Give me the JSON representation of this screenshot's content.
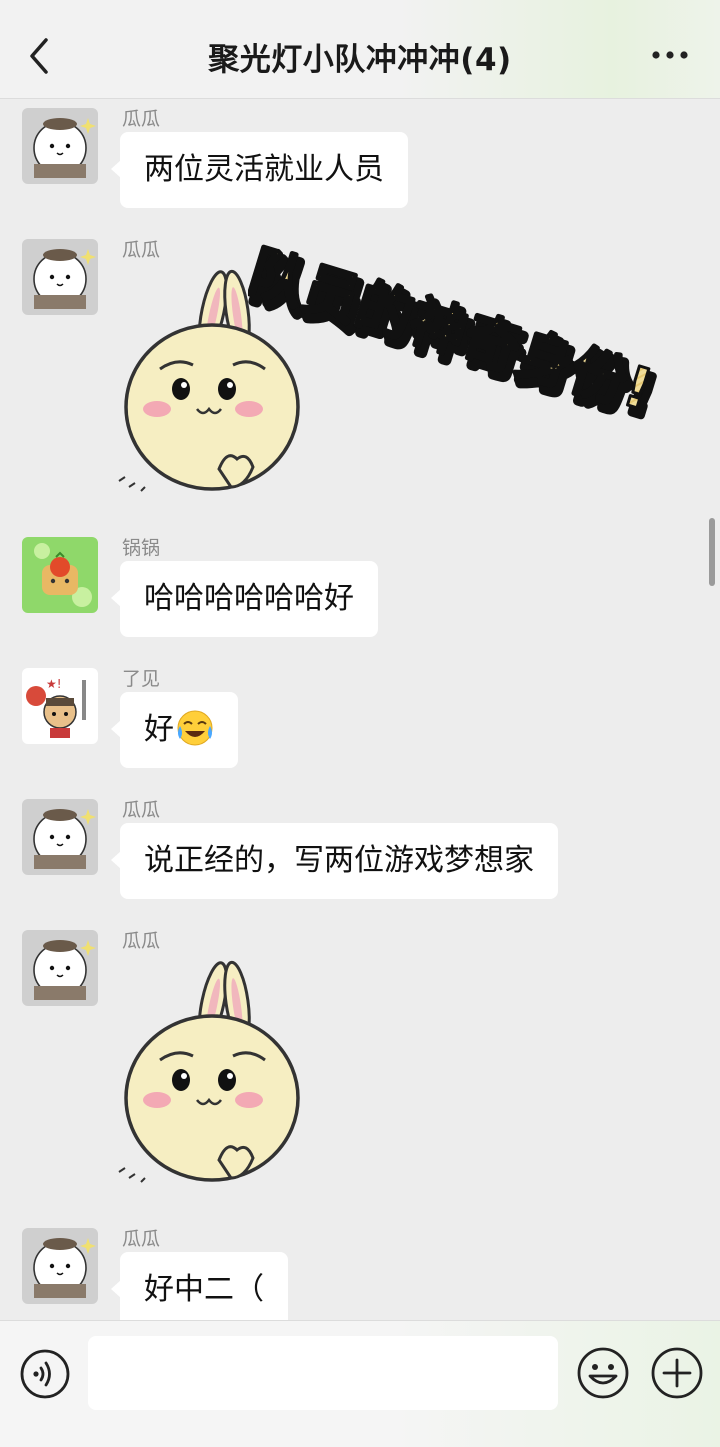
{
  "header": {
    "title": "聚光灯小队冲冲冲(4)",
    "back_icon": "chevron-left-icon",
    "more_icon": "more-dots-icon"
  },
  "messages": [
    {
      "sender": "瓜瓜",
      "type": "text",
      "text": "两位灵活就业人员",
      "avatar": "white-bear-avatar"
    },
    {
      "sender": "瓜瓜",
      "type": "sticker",
      "sticker": "bunny-sticker",
      "avatar": "white-bear-avatar"
    },
    {
      "sender": "锅锅",
      "type": "text",
      "text": "哈哈哈哈哈哈好",
      "avatar": "green-cat-avatar"
    },
    {
      "sender": "了见",
      "type": "text",
      "text": "好",
      "emoji": "crying-laughing-emoji",
      "avatar": "cat-warrior-avatar"
    },
    {
      "sender": "瓜瓜",
      "type": "text",
      "text": "说正经的，写两位游戏梦想家",
      "avatar": "white-bear-avatar"
    },
    {
      "sender": "瓜瓜",
      "type": "sticker",
      "sticker": "bunny-sticker",
      "avatar": "white-bear-avatar"
    },
    {
      "sender": "瓜瓜",
      "type": "text",
      "text": "好中二（",
      "avatar": "white-bear-avatar"
    }
  ],
  "overlay": {
    "text": "队员的神奇身份!"
  },
  "input_bar": {
    "voice_icon": "voice-icon",
    "emoji_icon": "emoji-icon",
    "plus_icon": "plus-icon",
    "input_value": ""
  },
  "colors": {
    "background": "#ededed",
    "bubble": "#ffffff",
    "overlay_fill": "#f0dc98",
    "sticker_fill": "#f6eec2"
  }
}
